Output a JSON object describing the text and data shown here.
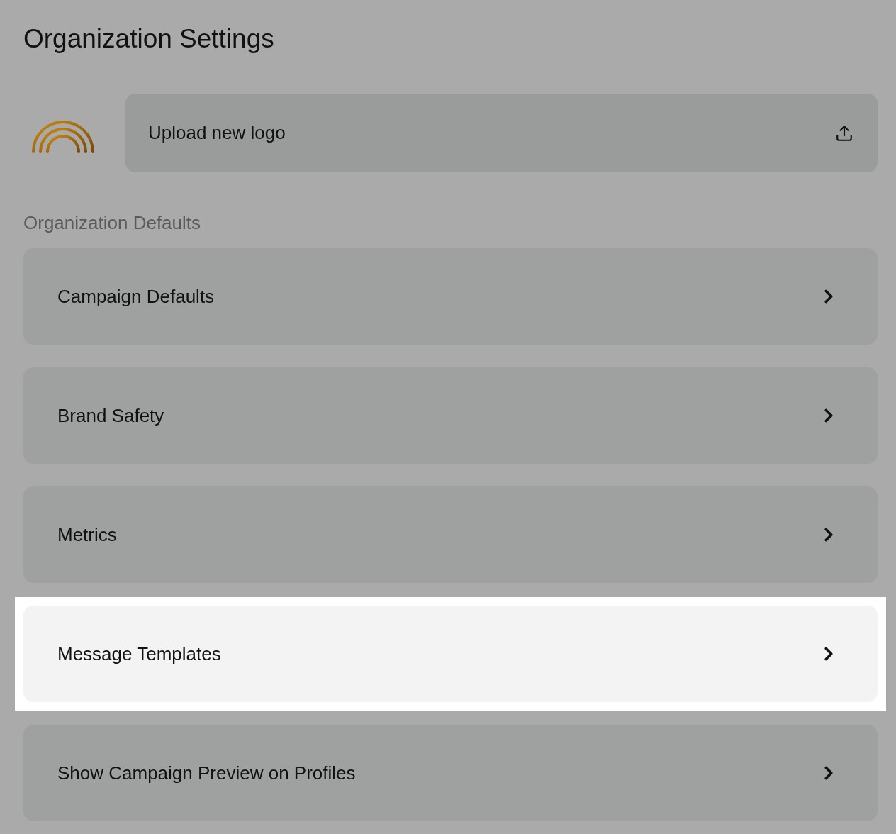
{
  "page": {
    "title": "Organization Settings"
  },
  "logo_upload": {
    "label": "Upload new logo"
  },
  "section": {
    "title": "Organization Defaults"
  },
  "items": [
    {
      "label": "Campaign Defaults",
      "highlighted": false
    },
    {
      "label": "Brand Safety",
      "highlighted": false
    },
    {
      "label": "Metrics",
      "highlighted": false
    },
    {
      "label": "Message Templates",
      "highlighted": true
    },
    {
      "label": "Show Campaign Preview on Profiles",
      "highlighted": false
    }
  ]
}
